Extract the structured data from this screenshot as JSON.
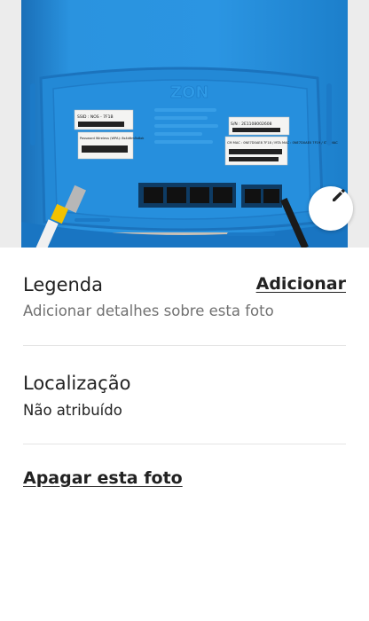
{
  "photo": {
    "icon": "router-photo",
    "device_brand_text": "ZON",
    "label_left_top": "SSID : NOS - 7F1B",
    "label_left_bottom": "Password Wireless (WPA): 8s4d6m5s6xk",
    "label_right_top": "S/N : 2E1108002608",
    "label_right_bottom": "CM MAC : 0NE7D0AE8 7F18 / MTA MAC : 0NE7D0AE0 7F19 / STB MAC"
  },
  "edit_button": {
    "icon": "pencil-icon"
  },
  "caption": {
    "title": "Legenda",
    "add_label": "Adicionar",
    "subtitle": "Adicionar detalhes sobre esta foto"
  },
  "location": {
    "title": "Localização",
    "value": "Não atribuído"
  },
  "actions": {
    "delete_label": "Apagar esta foto"
  },
  "colors": {
    "router_blue": "#1b86d6",
    "text_primary": "#222222",
    "text_secondary": "#717171"
  }
}
